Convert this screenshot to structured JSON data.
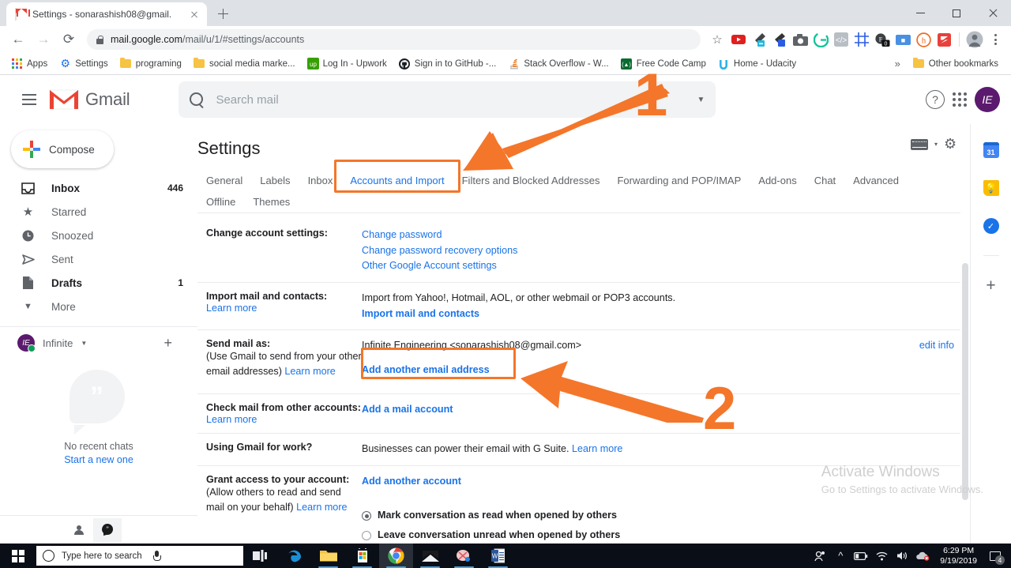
{
  "browser": {
    "tab": {
      "title": "Settings - sonarashish08@gmail.",
      "favicon": "gmail-favicon"
    },
    "newtab_label": "+",
    "window_controls": {
      "minimize": "minimize",
      "maximize": "maximize",
      "close": "close"
    },
    "nav": {
      "back": "back-icon",
      "forward": "forward-icon",
      "reload": "reload-icon"
    },
    "url": {
      "domain": "mail.google.com",
      "path": "/mail/u/1/#settings/accounts",
      "secure": true
    },
    "extensions": [
      {
        "name": "youtube-downloader-extension",
        "color": "#e02020"
      },
      {
        "name": "color-picker-extension",
        "color": "#22b8e0"
      },
      {
        "name": "eyedropper-extension",
        "color": "#2b5ce6"
      },
      {
        "name": "screenshot-extension",
        "color": "#5f6368"
      },
      {
        "name": "grammarly-extension",
        "color": "#15c39a"
      },
      {
        "name": "code-extension",
        "color": "#9aa0a6"
      },
      {
        "name": "grid-ruler-extension",
        "color": "#2b5ce6"
      },
      {
        "name": "whatfont-extension",
        "color": "#3c4043",
        "badge": "0"
      },
      {
        "name": "bitly-extension",
        "color": "#2b5ce6"
      },
      {
        "name": "honey-extension",
        "color": "#f06a1e"
      },
      {
        "name": "zapier-extension",
        "color": "#e8403a"
      }
    ],
    "bookmarks": [
      {
        "label": "Apps",
        "icon": "apps-grid-icon"
      },
      {
        "label": "Settings",
        "icon": "gear-icon"
      },
      {
        "label": "programing",
        "icon": "folder-icon"
      },
      {
        "label": "social media marke...",
        "icon": "folder-icon"
      },
      {
        "label": "Log In - Upwork",
        "icon": "upwork-icon"
      },
      {
        "label": "Sign in to GitHub -...",
        "icon": "github-icon"
      },
      {
        "label": "Stack Overflow - W...",
        "icon": "stackoverflow-icon"
      },
      {
        "label": "Free Code Camp",
        "icon": "freecodecamp-icon"
      },
      {
        "label": "Home - Udacity",
        "icon": "udacity-icon"
      }
    ],
    "bookmarks_overflow": "»",
    "other_bookmarks": "Other bookmarks"
  },
  "gmail": {
    "hamburger": "main-menu",
    "logo_text": "Gmail",
    "search": {
      "placeholder": "Search mail",
      "value": ""
    },
    "header_icons": {
      "help": "?",
      "apps": "apps-grid",
      "avatar_initials": "IE"
    },
    "compose_label": "Compose",
    "nav_items": [
      {
        "label": "Inbox",
        "count": "446",
        "icon": "inbox-icon",
        "bold": true
      },
      {
        "label": "Starred",
        "count": "",
        "icon": "star-icon",
        "bold": false
      },
      {
        "label": "Snoozed",
        "count": "",
        "icon": "clock-icon",
        "bold": false
      },
      {
        "label": "Sent",
        "count": "",
        "icon": "send-icon",
        "bold": false
      },
      {
        "label": "Drafts",
        "count": "1",
        "icon": "draft-icon",
        "bold": true
      },
      {
        "label": "More",
        "count": "",
        "icon": "chevron-down-icon",
        "bold": false
      }
    ],
    "user": {
      "name": "Infinite",
      "initials": "IE",
      "add_label": "+"
    },
    "chat": {
      "empty_text": "No recent chats",
      "start_link": "Start a new one"
    },
    "sidebar_bottom": {
      "contacts": "contacts-icon",
      "hangouts": "hangouts-icon"
    },
    "rail": [
      {
        "name": "google-calendar-icon",
        "label": "31"
      },
      {
        "name": "google-keep-icon",
        "label": ""
      },
      {
        "name": "google-tasks-icon",
        "label": ""
      },
      {
        "name": "add-addon-icon",
        "label": "+"
      }
    ]
  },
  "settings": {
    "title": "Settings",
    "tools": {
      "keyboard": "input-tools-icon",
      "caret": "▾",
      "gear": "gear-icon"
    },
    "tabs": [
      {
        "label": "General",
        "active": false
      },
      {
        "label": "Labels",
        "active": false
      },
      {
        "label": "Inbox",
        "active": false
      },
      {
        "label": "Accounts and Import",
        "active": true
      },
      {
        "label": "Filters and Blocked Addresses",
        "active": false
      },
      {
        "label": "Forwarding and POP/IMAP",
        "active": false
      },
      {
        "label": "Add-ons",
        "active": false
      },
      {
        "label": "Chat",
        "active": false
      },
      {
        "label": "Advanced",
        "active": false
      },
      {
        "label": "Offline",
        "active": false
      },
      {
        "label": "Themes",
        "active": false
      }
    ],
    "rows": {
      "change_account": {
        "label": "Change account settings:",
        "links": [
          "Change password",
          "Change password recovery options",
          "Other Google Account settings"
        ]
      },
      "import_mail": {
        "label": "Import mail and contacts:",
        "learn_more": "Learn more",
        "description": "Import from Yahoo!, Hotmail, AOL, or other webmail or POP3 accounts.",
        "action": "Import mail and contacts"
      },
      "send_mail_as": {
        "label": "Send mail as:",
        "sub": "(Use Gmail to send from your other email addresses)",
        "learn_more": "Learn more",
        "address": "Infinite Engineering <sonarashish08@gmail.com>",
        "edit_info": "edit info",
        "action": "Add another email address"
      },
      "check_mail": {
        "label": "Check mail from other accounts:",
        "learn_more": "Learn more",
        "action": "Add a mail account"
      },
      "gmail_for_work": {
        "label": "Using Gmail for work?",
        "description": "Businesses can power their email with G Suite.",
        "learn_more": "Learn more"
      },
      "grant_access": {
        "label": "Grant access to your account:",
        "sub": "(Allow others to read and send mail on your behalf)",
        "learn_more": "Learn more",
        "action": "Add another account",
        "option_read": "Mark conversation as read when opened by others",
        "option_unread": "Leave conversation unread when opened by others",
        "selected": "option_read"
      }
    }
  },
  "annotations": {
    "accent_color": "#f4762a",
    "step_1": "1",
    "step_2": "2",
    "highlight_1_target": "Accounts and Import",
    "highlight_2_target": "Add another email address"
  },
  "watermark": {
    "line1": "Activate Windows",
    "line2": "Go to Settings to activate Windows."
  },
  "taskbar": {
    "start": "windows-start-icon",
    "search_placeholder": "Type here to search",
    "mic": "microphone-icon",
    "apps": [
      {
        "name": "task-view-icon",
        "running": false
      },
      {
        "name": "microsoft-edge-icon",
        "running": false
      },
      {
        "name": "file-explorer-icon",
        "running": true
      },
      {
        "name": "microsoft-store-icon",
        "running": true
      },
      {
        "name": "google-chrome-icon",
        "running": true,
        "active": true
      },
      {
        "name": "mail-icon",
        "running": true
      },
      {
        "name": "snipping-tool-icon",
        "running": true
      },
      {
        "name": "microsoft-word-icon",
        "running": true
      }
    ],
    "tray": [
      {
        "name": "people-icon"
      },
      {
        "name": "show-hidden-icons-icon"
      },
      {
        "name": "battery-icon"
      },
      {
        "name": "wifi-icon"
      },
      {
        "name": "volume-icon"
      },
      {
        "name": "onedrive-error-icon"
      }
    ],
    "time": "6:29 PM",
    "date": "9/19/2019",
    "notification_count": "4"
  }
}
